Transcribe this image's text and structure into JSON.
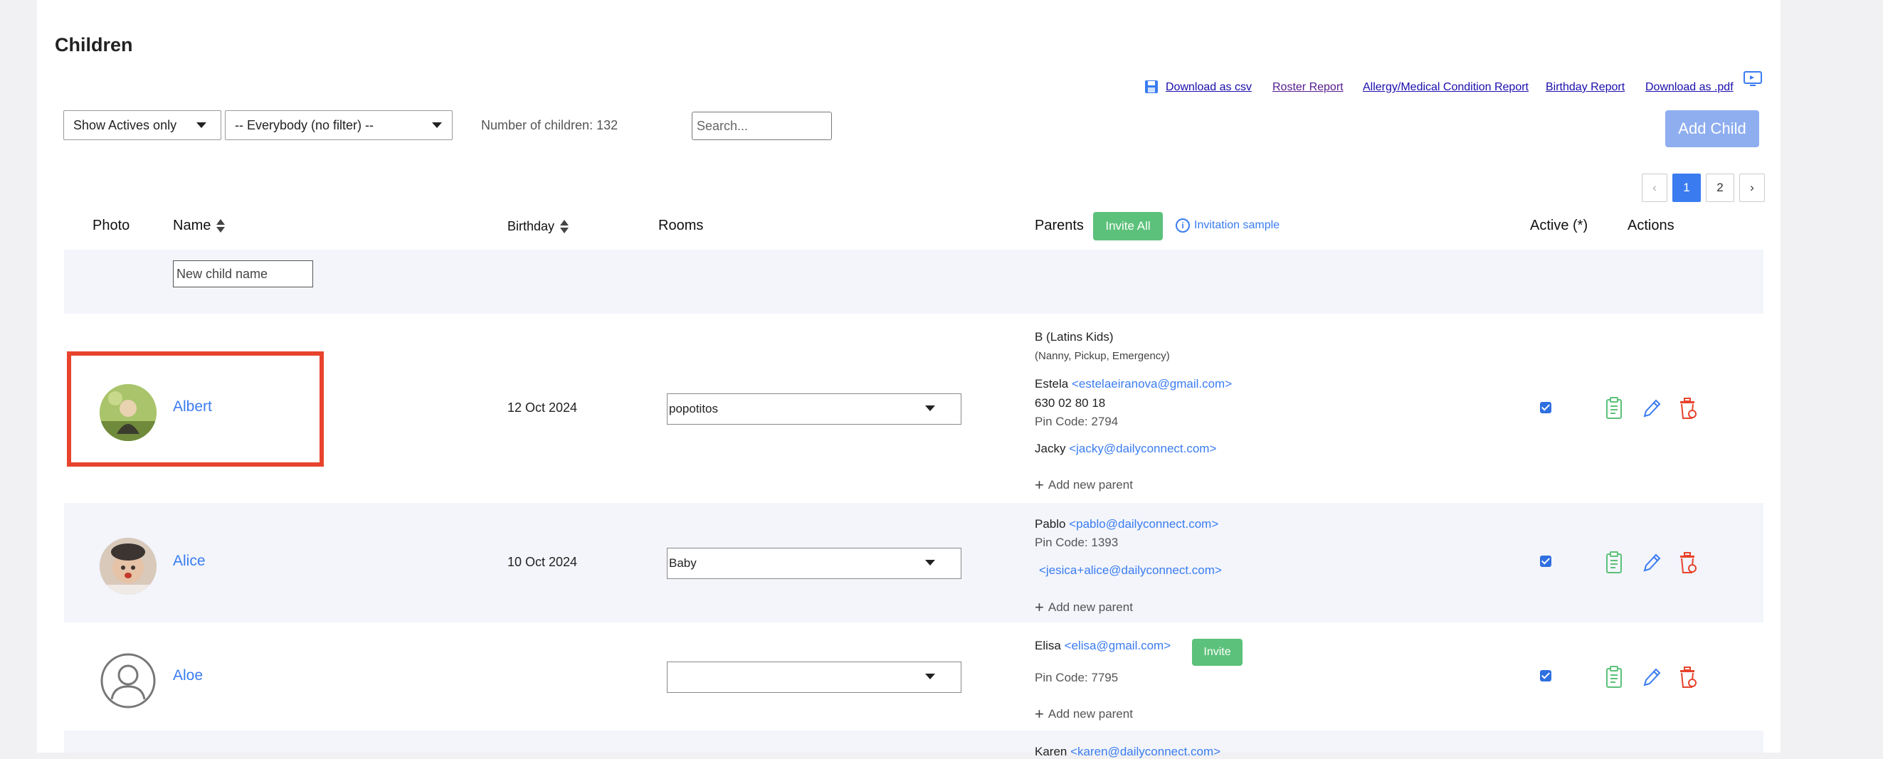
{
  "page": {
    "title": "Children"
  },
  "toolbar_links": {
    "download_csv": "Download as csv",
    "roster_report": "Roster Report",
    "allergy_report": "Allergy/Medical Condition Report",
    "birthday_report": "Birthday Report",
    "download_pdf": "Download as .pdf"
  },
  "filters": {
    "status_selected": "Show Actives only",
    "group_selected": "-- Everybody (no filter) --",
    "count_text": "Number of children: 132",
    "search_placeholder": "Search..."
  },
  "add_child_label": "Add Child",
  "pagination": {
    "prev": "‹",
    "pages": [
      "1",
      "2"
    ],
    "current": "1",
    "next": "›"
  },
  "columns": {
    "photo": "Photo",
    "name": "Name",
    "birthday": "Birthday",
    "rooms": "Rooms",
    "parents": "Parents",
    "invite_all": "Invite All",
    "invitation_sample": "Invitation sample",
    "active": "Active (*)",
    "actions": "Actions"
  },
  "new_child_placeholder": "New child name",
  "children": [
    {
      "name": "Albert",
      "birthday": "12 Oct 2024",
      "room": "popotitos",
      "active": true,
      "parents_block": {
        "group_name": "B (Latins Kids)",
        "group_roles": "(Nanny, Pickup, Emergency)",
        "p1_name": "Estela",
        "p1_email": "<estelaeiranova@gmail.com>",
        "p1_phone": "630 02 80 18",
        "p1_pin": "Pin Code: 2794",
        "p2_name": "Jacky",
        "p2_email": "<jacky@dailyconnect.com>"
      },
      "add_parent": "Add new parent"
    },
    {
      "name": "Alice",
      "birthday": "10 Oct 2024",
      "room": "Baby",
      "active": true,
      "parents_block": {
        "p1_name": "Pablo",
        "p1_email": "<pablo@dailyconnect.com>",
        "p1_pin": "Pin Code: 1393",
        "p2_email": "<jesica+alice@dailyconnect.com>"
      },
      "add_parent": "Add new parent"
    },
    {
      "name": "Aloe",
      "birthday": "",
      "room": "",
      "active": true,
      "parents_block": {
        "p1_name": "Elisa",
        "p1_email": "<elisa@gmail.com>",
        "invite_label": "Invite",
        "p1_pin": "Pin Code: 7795"
      },
      "add_parent": "Add new parent"
    },
    {
      "parents_block": {
        "p1_name": "Karen",
        "p1_email": "<karen@dailyconnect.com>"
      }
    }
  ],
  "icons": {
    "save": "floppy-disk-icon",
    "monitor": "monitor-icon",
    "clipboard": "clipboard-icon",
    "edit": "pencil-icon",
    "delete": "trash-icon",
    "sort": "sort-icon",
    "info": "info-icon",
    "plus": "plus-icon"
  },
  "colors": {
    "accent": "#3a7cf0",
    "add_child_bg": "#8faef0",
    "green": "#5cc17a",
    "delete_red": "#e8432c",
    "highlight_border": "#e8432c",
    "row_alt_bg": "#f3f5fb"
  }
}
